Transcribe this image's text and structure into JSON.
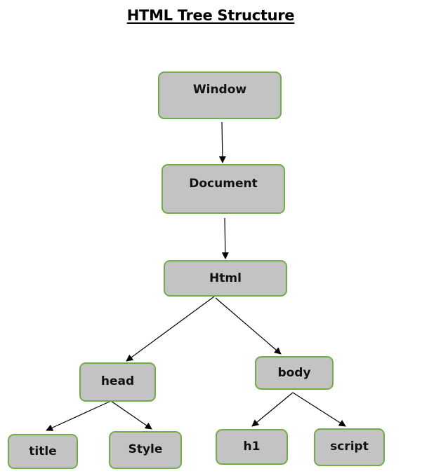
{
  "title": "HTML Tree Structure",
  "colors": {
    "node_fill": "#c3c3c3",
    "node_border": "#70ad47",
    "edge": "#000000"
  },
  "nodes": {
    "window": {
      "label": "Window"
    },
    "document": {
      "label": "Document"
    },
    "html": {
      "label": "Html"
    },
    "head": {
      "label": "head"
    },
    "body": {
      "label": "body"
    },
    "title": {
      "label": "title"
    },
    "style": {
      "label": "Style"
    },
    "h1": {
      "label": "h1"
    },
    "script": {
      "label": "script"
    }
  },
  "edges": [
    {
      "from": "window",
      "to": "document"
    },
    {
      "from": "document",
      "to": "html"
    },
    {
      "from": "html",
      "to": "head"
    },
    {
      "from": "html",
      "to": "body"
    },
    {
      "from": "head",
      "to": "title"
    },
    {
      "from": "head",
      "to": "style"
    },
    {
      "from": "body",
      "to": "h1"
    },
    {
      "from": "body",
      "to": "script"
    }
  ]
}
